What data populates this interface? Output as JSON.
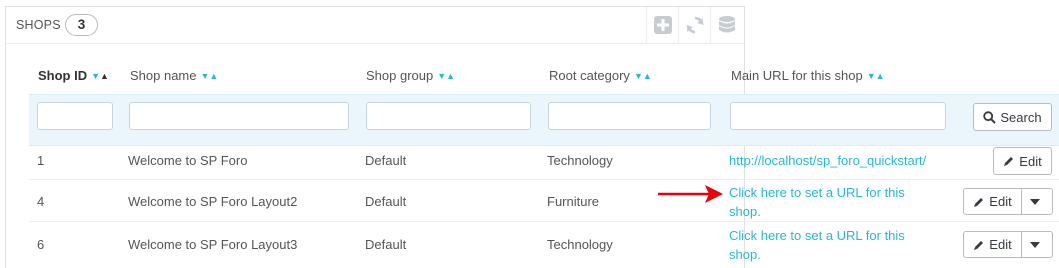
{
  "panel": {
    "title": "SHOPS",
    "count": "3",
    "toolbar": [
      {
        "icon": "plus-square-icon"
      },
      {
        "icon": "refresh-icon"
      },
      {
        "icon": "database-icon"
      }
    ]
  },
  "columns": [
    {
      "label": "Shop ID",
      "active": true
    },
    {
      "label": "Shop name"
    },
    {
      "label": "Shop group"
    },
    {
      "label": "Root category"
    },
    {
      "label": "Main URL for this shop"
    }
  ],
  "filters": {
    "shop_id": "",
    "shop_name": "",
    "shop_group": "",
    "root_category": "",
    "main_url": "",
    "search_label": "Search"
  },
  "rows": [
    {
      "id": "1",
      "name": "Welcome to SP Foro",
      "group": "Default",
      "category": "Technology",
      "url_line1": "http://localhost/sp_foro_quickstart/",
      "url_line2": "",
      "edit_label": "Edit"
    },
    {
      "id": "4",
      "name": "Welcome to SP Foro Layout2",
      "group": "Default",
      "category": "Furniture",
      "url_line1": "Click here to set a URL for this",
      "url_line2": "shop.",
      "edit_label": "Edit"
    },
    {
      "id": "6",
      "name": "Welcome to SP Foro Layout3",
      "group": "Default",
      "category": "Technology",
      "url_line1": "Click here to set a URL for this",
      "url_line2": "shop.",
      "edit_label": "Edit"
    }
  ],
  "colors": {
    "link": "#25b9d7",
    "arrow": "#e8000b",
    "filter_bg": "#eaf6fc"
  }
}
